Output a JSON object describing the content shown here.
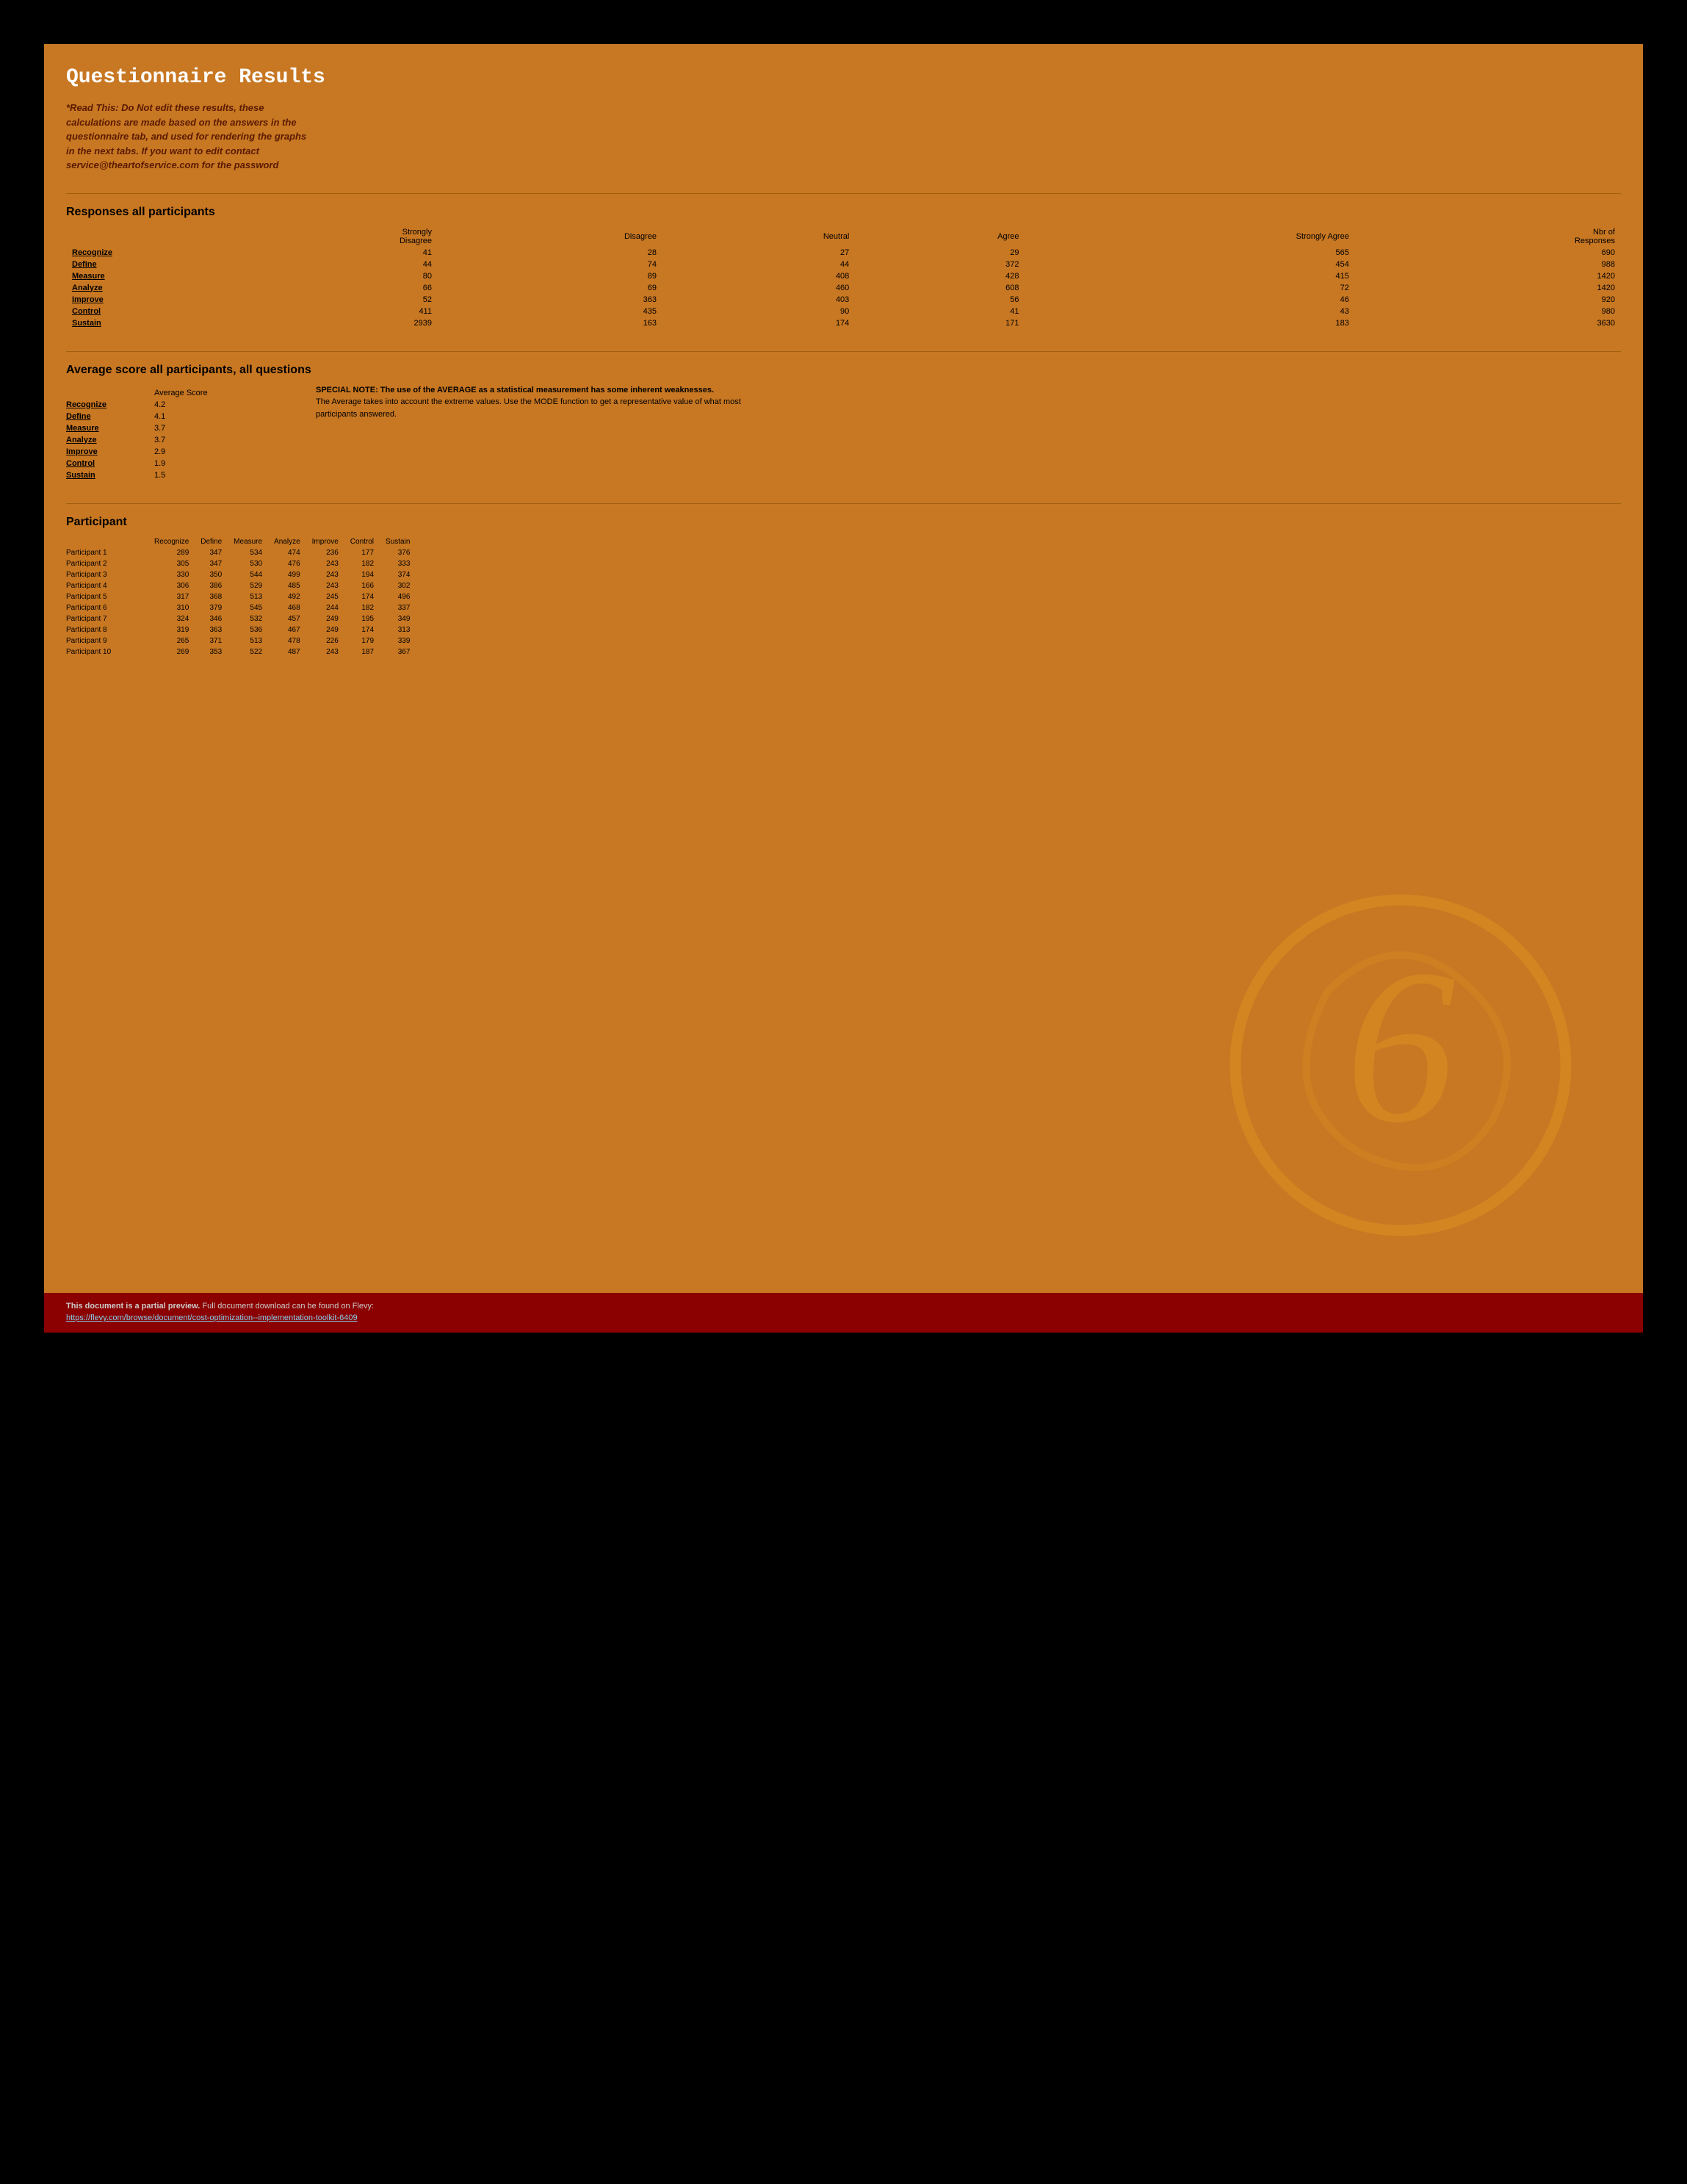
{
  "page": {
    "title": "Questionnaire Results",
    "disclaimer": "*Read This: Do Not edit these results, these calculations are made based on the answers in the questionnaire tab, and used for rendering the graphs in the next tabs. If you want to edit contact service@theartofservice.com for the password"
  },
  "responses_section": {
    "title": "Responses all participants",
    "columns": [
      "Strongly Disagree",
      "Disagree",
      "Neutral",
      "Agree",
      "Strongly Agree",
      "Nbr of Responses"
    ],
    "rows": [
      {
        "label": "Recognize",
        "sd": 41,
        "d": 28,
        "n": 27,
        "a": 29,
        "sa": 565,
        "nbr": 690
      },
      {
        "label": "Define",
        "sd": 44,
        "d": 74,
        "n": 44,
        "a": 372,
        "sa": 454,
        "nbr": 988
      },
      {
        "label": "Measure",
        "sd": 80,
        "d": 89,
        "n": 408,
        "a": 428,
        "sa": 415,
        "nbr": 1420
      },
      {
        "label": "Analyze",
        "sd": 66,
        "d": 69,
        "n": 460,
        "a": 608,
        "sa": 72,
        "nbr": 1420
      },
      {
        "label": "Improve",
        "sd": 52,
        "d": 363,
        "n": 403,
        "a": 56,
        "sa": 46,
        "nbr": 920
      },
      {
        "label": "Control",
        "sd": 411,
        "d": 435,
        "n": 90,
        "a": 41,
        "sa": 43,
        "nbr": 980
      },
      {
        "label": "Sustain",
        "sd": 2939,
        "d": 163,
        "n": 174,
        "a": 171,
        "sa": 183,
        "nbr": 3630
      }
    ]
  },
  "avg_section": {
    "title": "Average score all participants, all questions",
    "column_header": "Average Score",
    "rows": [
      {
        "label": "Recognize",
        "score": "4.2"
      },
      {
        "label": "Define",
        "score": "4.1"
      },
      {
        "label": "Measure",
        "score": "3.7"
      },
      {
        "label": "Analyze",
        "score": "3.7"
      },
      {
        "label": "Improve",
        "score": "2.9"
      },
      {
        "label": "Control",
        "score": "1.9"
      },
      {
        "label": "Sustain",
        "score": "1.5"
      }
    ],
    "note_title": "SPECIAL NOTE: The use of the AVERAGE as a statistical measurement has some inherent weaknesses.",
    "note_body": "The Average takes into account the extreme values. Use the MODE function to get a representative value of what most participants answered."
  },
  "participant_section": {
    "title": "Participant",
    "columns": [
      "Recognize",
      "Define",
      "Measure",
      "Analyze",
      "Improve",
      "Control",
      "Sustain"
    ],
    "rows": [
      {
        "label": "Participant 1",
        "recognize": 289,
        "define": 347,
        "measure": 534,
        "analyze": 474,
        "improve": 236,
        "control": 177,
        "sustain": 376
      },
      {
        "label": "Participant 2",
        "recognize": 305,
        "define": 347,
        "measure": 530,
        "analyze": 476,
        "improve": 243,
        "control": 182,
        "sustain": 333
      },
      {
        "label": "Participant 3",
        "recognize": 330,
        "define": 350,
        "measure": 544,
        "analyze": 499,
        "improve": 243,
        "control": 194,
        "sustain": 374
      },
      {
        "label": "Participant 4",
        "recognize": 306,
        "define": 386,
        "measure": 529,
        "analyze": 485,
        "improve": 243,
        "control": 166,
        "sustain": 302
      },
      {
        "label": "Participant 5",
        "recognize": 317,
        "define": 368,
        "measure": 513,
        "analyze": 492,
        "improve": 245,
        "control": 174,
        "sustain": 496
      },
      {
        "label": "Participant 6",
        "recognize": 310,
        "define": 379,
        "measure": 545,
        "analyze": 468,
        "improve": 244,
        "control": 182,
        "sustain": 337
      },
      {
        "label": "Participant 7",
        "recognize": 324,
        "define": 346,
        "measure": 532,
        "analyze": 457,
        "improve": 249,
        "control": 195,
        "sustain": 349
      },
      {
        "label": "Participant 8",
        "recognize": 319,
        "define": 363,
        "measure": 536,
        "analyze": 467,
        "improve": 249,
        "control": 174,
        "sustain": 313
      },
      {
        "label": "Participant 9",
        "recognize": 265,
        "define": 371,
        "measure": 513,
        "analyze": 478,
        "improve": 226,
        "control": 179,
        "sustain": 339
      },
      {
        "label": "Participant 10",
        "recognize": 269,
        "define": 353,
        "measure": 522,
        "analyze": 487,
        "improve": 243,
        "control": 187,
        "sustain": 367
      }
    ]
  },
  "footer": {
    "preview_text": "This document is a partial preview.",
    "download_text": " Full document download can be found on Flevy:",
    "link_url": "https://flevy.com/browse/document/cost-optimization--implementation-toolkit-6409",
    "link_text": "https://flevy.com/browse/document/cost-optimization--implementation-toolkit-6409"
  }
}
